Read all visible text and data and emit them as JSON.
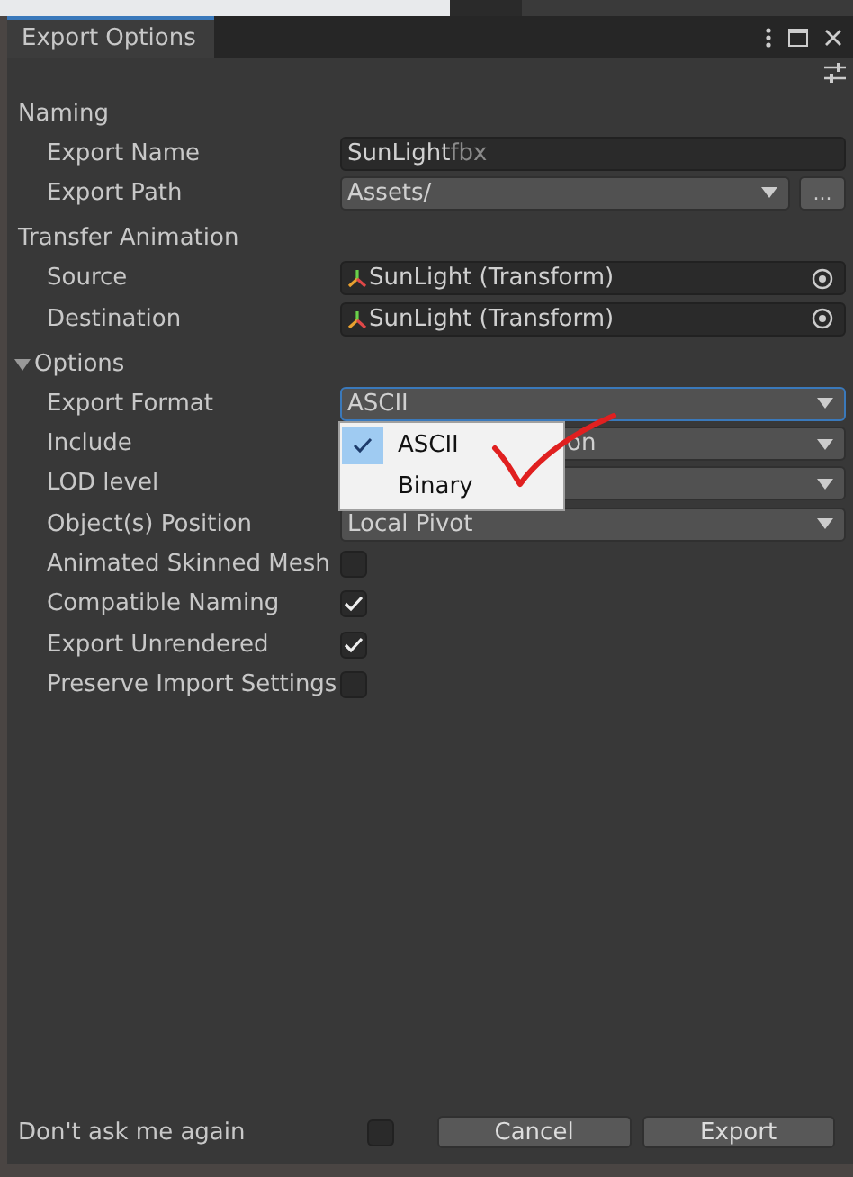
{
  "window": {
    "title": "Export Options"
  },
  "sections": [
    {
      "title": "Naming",
      "collapsible": false,
      "rows": [
        {
          "kind": "text",
          "label": "Export Name",
          "value": "SunLight",
          "suffix": "fbx"
        },
        {
          "kind": "path",
          "label": "Export Path",
          "value": "Assets/",
          "button": "..."
        }
      ]
    },
    {
      "title": "Transfer Animation",
      "collapsible": false,
      "rows": [
        {
          "kind": "object",
          "label": "Source",
          "value": "SunLight (Transform)"
        },
        {
          "kind": "object",
          "label": "Destination",
          "value": "SunLight (Transform)"
        }
      ]
    },
    {
      "title": "Options",
      "collapsible": true,
      "expanded": true,
      "rows": [
        {
          "kind": "dropdown",
          "label": "Export Format",
          "value": "ASCII",
          "focused": true,
          "popup": [
            {
              "label": "ASCII",
              "selected": true
            },
            {
              "label": "Binary",
              "selected": false
            }
          ]
        },
        {
          "kind": "dropdown",
          "label": "Include",
          "value": "on",
          "focused": false,
          "covered": true
        },
        {
          "kind": "dropdown",
          "label": "LOD level",
          "focused": false
        },
        {
          "kind": "dropdown",
          "label": "Object(s) Position",
          "value": "Local Pivot",
          "focused": false
        },
        {
          "kind": "checkbox",
          "label": "Animated Skinned Mesh",
          "checked": false
        },
        {
          "kind": "checkbox",
          "label": "Compatible Naming",
          "checked": true
        },
        {
          "kind": "checkbox",
          "label": "Export Unrendered",
          "checked": true
        },
        {
          "kind": "checkbox",
          "label": "Preserve Import Settings",
          "checked": false
        }
      ]
    }
  ],
  "footer": {
    "label": "Don't ask me again",
    "checked": false,
    "buttons": [
      "Cancel",
      "Export"
    ]
  }
}
